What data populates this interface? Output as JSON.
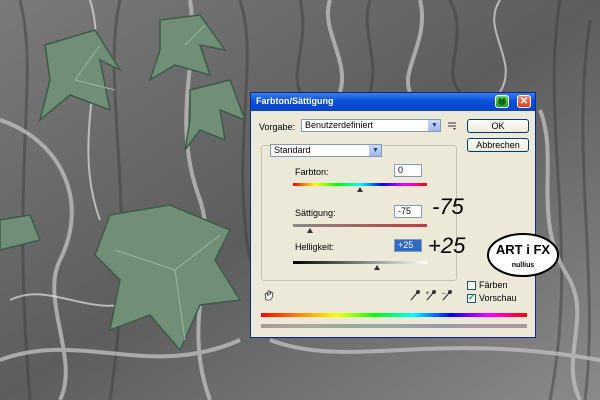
{
  "dialog": {
    "title": "Farbton/Sättigung",
    "vorgabe_label": "Vorgabe:",
    "vorgabe_value": "Benutzerdefiniert",
    "ok_label": "OK",
    "cancel_label": "Abbrechen",
    "channel_value": "Standard",
    "sliders": [
      {
        "label": "Farbton:",
        "value": "0",
        "level": 0
      },
      {
        "label": "Sättigung:",
        "value": "-75",
        "level": -75
      },
      {
        "label": "Helligkeit:",
        "value": "+25",
        "level": 25
      }
    ],
    "faerben_label": "Färben",
    "faerben_checked": false,
    "vorschau_label": "Vorschau",
    "vorschau_checked": true
  },
  "annotations": {
    "saturation": "-75",
    "lightness": "+25"
  },
  "logo": {
    "text_top": "ART i FX",
    "text_bottom": "nullius"
  },
  "colors": {
    "title_bar": "#0b4fd8",
    "dialog_bg": "#ece9d8",
    "active_field": "#316ac5",
    "saturation_track": "#c23a3a"
  }
}
